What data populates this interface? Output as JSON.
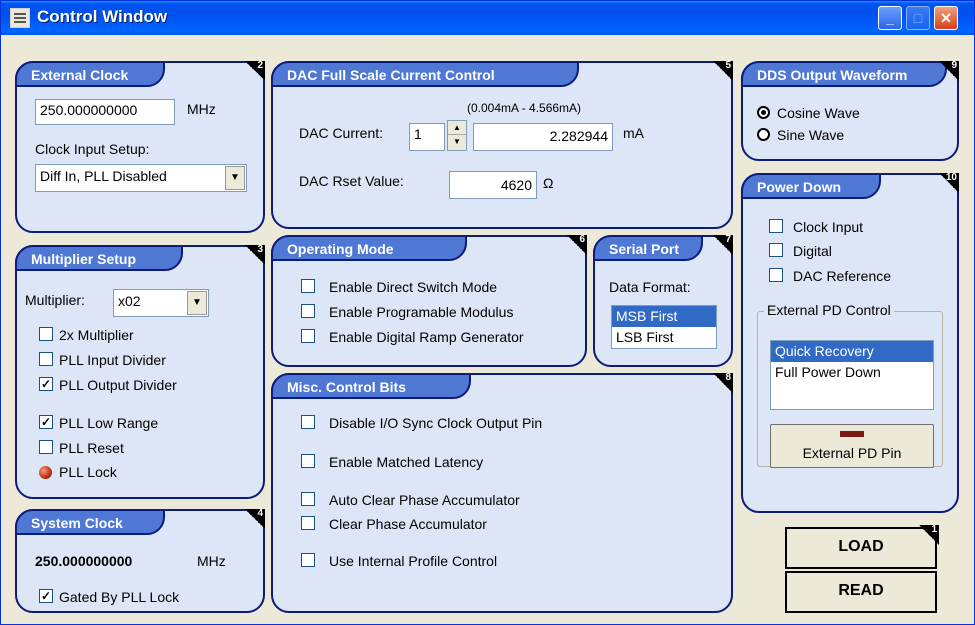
{
  "window": {
    "title": "Control Window"
  },
  "external_clock": {
    "title": "External Clock",
    "num": "2",
    "value": "250.000000000",
    "unit": "MHz",
    "setup_label": "Clock Input Setup:",
    "setup_value": "Diff In, PLL Disabled"
  },
  "multiplier": {
    "title": "Multiplier Setup",
    "num": "3",
    "label": "Multiplier:",
    "value": "x02",
    "items": [
      {
        "label": "2x Multiplier",
        "checked": false
      },
      {
        "label": "PLL Input Divider",
        "checked": false
      },
      {
        "label": "PLL Output Divider",
        "checked": true
      },
      {
        "label": "PLL Low Range",
        "checked": true
      },
      {
        "label": "PLL Reset",
        "checked": false
      }
    ],
    "lock_label": "PLL Lock"
  },
  "system_clock": {
    "title": "System Clock",
    "num": "4",
    "value": "250.000000000",
    "unit": "MHz",
    "gated_label": "Gated By PLL Lock",
    "gated_checked": true
  },
  "dac": {
    "title": "DAC Full Scale Current Control",
    "num": "5",
    "range": "(0.004mA - 4.566mA)",
    "current_label": "DAC Current:",
    "step": "1",
    "current_value": "2.282944",
    "unit": "mA",
    "rset_label": "DAC Rset Value:",
    "rset_value": "4620",
    "rset_unit": "Ω"
  },
  "operating_mode": {
    "title": "Operating Mode",
    "num": "6",
    "items": [
      {
        "label": "Enable Direct Switch Mode",
        "checked": false
      },
      {
        "label": "Enable Programable Modulus",
        "checked": false
      },
      {
        "label": "Enable Digital Ramp Generator",
        "checked": false
      }
    ]
  },
  "serial_port": {
    "title": "Serial Port",
    "num": "7",
    "format_label": "Data Format:",
    "options": [
      "MSB First",
      "LSB First"
    ],
    "selected": "MSB First"
  },
  "misc": {
    "title": "Misc. Control Bits",
    "num": "8",
    "items": [
      {
        "label": "Disable I/O Sync Clock Output Pin",
        "checked": false
      },
      {
        "label": "Enable Matched Latency",
        "checked": false
      },
      {
        "label": "Auto Clear Phase Accumulator",
        "checked": false
      },
      {
        "label": "Clear Phase Accumulator",
        "checked": false
      },
      {
        "label": "Use Internal Profile Control",
        "checked": false
      }
    ]
  },
  "dds": {
    "title": "DDS Output Waveform",
    "num": "9",
    "options": [
      "Cosine Wave",
      "Sine Wave"
    ],
    "selected": "Cosine Wave"
  },
  "power_down": {
    "title": "Power Down",
    "num": "10",
    "items": [
      {
        "label": "Clock Input",
        "checked": false
      },
      {
        "label": "Digital",
        "checked": false
      },
      {
        "label": "DAC Reference",
        "checked": false
      }
    ],
    "ext_label": "External PD Control",
    "ext_options": [
      "Quick Recovery",
      "Full Power Down"
    ],
    "ext_selected": "Quick Recovery",
    "pin_label": "External PD Pin"
  },
  "actions": {
    "num": "1",
    "load": "LOAD",
    "read": "READ"
  }
}
